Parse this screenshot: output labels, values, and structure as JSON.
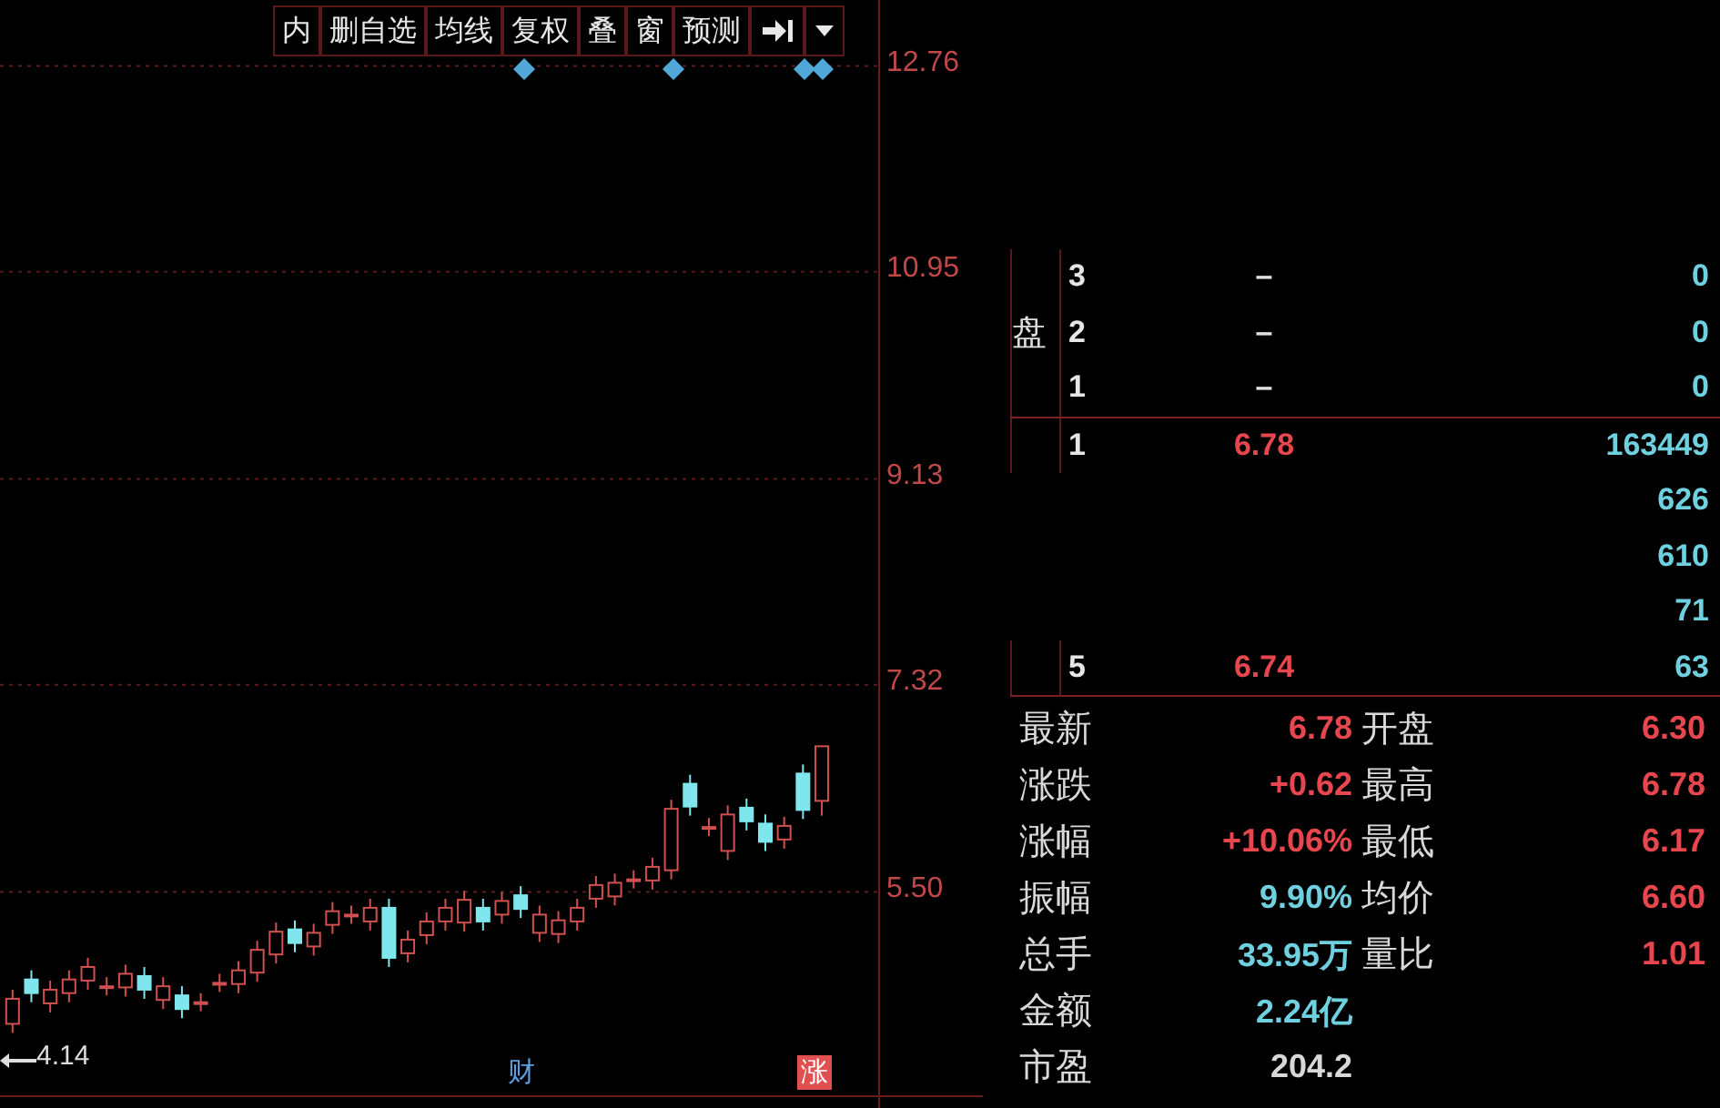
{
  "toolbar": {
    "buttons": [
      "内",
      "删自选",
      "均线",
      "复权",
      "叠",
      "窗",
      "预测"
    ]
  },
  "chart": {
    "chart_data": {
      "type": "candlestick",
      "grid": true,
      "ylim": [
        3.6,
        13.34
      ],
      "yticks": [
        {
          "value": 12.76,
          "label": "12.76"
        },
        {
          "value": 10.95,
          "label": "10.95"
        },
        {
          "value": 9.13,
          "label": "9.13"
        },
        {
          "value": 7.32,
          "label": "7.32"
        },
        {
          "value": 5.5,
          "label": "5.50"
        }
      ],
      "ohlc": [
        [
          4.34,
          4.64,
          4.26,
          4.56
        ],
        [
          4.73,
          4.81,
          4.53,
          4.61
        ],
        [
          4.52,
          4.72,
          4.44,
          4.64
        ],
        [
          4.61,
          4.81,
          4.53,
          4.73
        ],
        [
          4.72,
          4.92,
          4.64,
          4.84
        ],
        [
          4.67,
          4.75,
          4.59,
          4.67
        ],
        [
          4.66,
          4.86,
          4.58,
          4.78
        ],
        [
          4.76,
          4.84,
          4.56,
          4.64
        ],
        [
          4.55,
          4.75,
          4.47,
          4.67
        ],
        [
          4.59,
          4.67,
          4.39,
          4.47
        ],
        [
          4.53,
          4.61,
          4.45,
          4.53
        ],
        [
          4.7,
          4.78,
          4.62,
          4.7
        ],
        [
          4.69,
          4.89,
          4.61,
          4.81
        ],
        [
          4.79,
          5.07,
          4.71,
          4.99
        ],
        [
          4.95,
          5.23,
          4.87,
          5.15
        ],
        [
          5.17,
          5.25,
          4.97,
          5.05
        ],
        [
          5.02,
          5.22,
          4.94,
          5.14
        ],
        [
          5.21,
          5.41,
          5.13,
          5.33
        ],
        [
          5.3,
          5.38,
          5.22,
          5.3
        ],
        [
          5.24,
          5.44,
          5.16,
          5.36
        ],
        [
          5.36,
          5.44,
          4.84,
          4.92
        ],
        [
          4.96,
          5.16,
          4.88,
          5.08
        ],
        [
          5.12,
          5.32,
          5.04,
          5.24
        ],
        [
          5.24,
          5.44,
          5.16,
          5.36
        ],
        [
          5.23,
          5.51,
          5.15,
          5.43
        ],
        [
          5.36,
          5.44,
          5.16,
          5.24
        ],
        [
          5.3,
          5.5,
          5.22,
          5.42
        ],
        [
          5.47,
          5.55,
          5.27,
          5.35
        ],
        [
          5.14,
          5.38,
          5.06,
          5.3
        ],
        [
          5.13,
          5.33,
          5.05,
          5.25
        ],
        [
          5.24,
          5.44,
          5.16,
          5.36
        ],
        [
          5.44,
          5.64,
          5.36,
          5.56
        ],
        [
          5.46,
          5.66,
          5.38,
          5.58
        ],
        [
          5.61,
          5.69,
          5.53,
          5.61
        ],
        [
          5.6,
          5.8,
          5.52,
          5.72
        ],
        [
          5.69,
          6.31,
          5.61,
          6.23
        ],
        [
          6.45,
          6.53,
          6.17,
          6.25
        ],
        [
          6.07,
          6.15,
          5.99,
          6.07
        ],
        [
          5.86,
          6.26,
          5.78,
          6.18
        ],
        [
          6.24,
          6.32,
          6.04,
          6.12
        ],
        [
          6.1,
          6.18,
          5.86,
          5.94
        ],
        [
          5.96,
          6.16,
          5.88,
          6.08
        ],
        [
          6.54,
          6.62,
          6.14,
          6.22
        ],
        [
          6.3,
          6.78,
          6.17,
          6.78
        ]
      ]
    },
    "low_marker": "4.14",
    "event_markers": [
      {
        "label": "财",
        "color": "#5aa0e0"
      },
      {
        "label": "涨",
        "color": "#e05050"
      }
    ]
  },
  "order_book": {
    "side_label": "盘",
    "sell": [
      {
        "rank": "3",
        "price": "–",
        "volume": "0",
        "color": "#e0e0e0"
      },
      {
        "rank": "2",
        "price": "–",
        "volume": "0",
        "color": "#e0e0e0"
      },
      {
        "rank": "1",
        "price": "–",
        "volume": "0",
        "color": "#e0e0e0"
      }
    ],
    "buy": [
      {
        "rank": "1",
        "price": "6.78",
        "volume": "163449",
        "color": "#e8464e"
      },
      {
        "volume": "626"
      },
      {
        "volume": "610"
      },
      {
        "volume": "71"
      },
      {
        "rank": "5",
        "price": "6.74",
        "volume": "63",
        "color": "#e8464e"
      }
    ]
  },
  "stats": [
    {
      "left": {
        "label": "最新",
        "value": "6.78",
        "color": "#e8464e"
      },
      "right": {
        "label": "开盘",
        "value": "6.30",
        "color": "#e8464e"
      }
    },
    {
      "left": {
        "label": "涨跌",
        "value": "+0.62",
        "color": "#e8464e"
      },
      "right": {
        "label": "最高",
        "value": "6.78",
        "color": "#e8464e"
      }
    },
    {
      "left": {
        "label": "涨幅",
        "value": "+10.06%",
        "color": "#e8464e"
      },
      "right": {
        "label": "最低",
        "value": "6.17",
        "color": "#e8464e"
      }
    },
    {
      "left": {
        "label": "振幅",
        "value": "9.90%",
        "color": "#6fd0e0"
      },
      "right": {
        "label": "均价",
        "value": "6.60",
        "color": "#e8464e"
      }
    },
    {
      "left": {
        "label": "总手",
        "value": "33.95万",
        "color": "#6fd0e0"
      },
      "right": {
        "label": "量比",
        "value": "1.01",
        "color": "#e8464e"
      }
    },
    {
      "left": {
        "label": "金额",
        "value": "2.24亿",
        "color": "#6fd0e0"
      }
    },
    {
      "left": {
        "label": "市盈",
        "value": "204.2",
        "color": "#d8d8d8"
      }
    }
  ]
}
